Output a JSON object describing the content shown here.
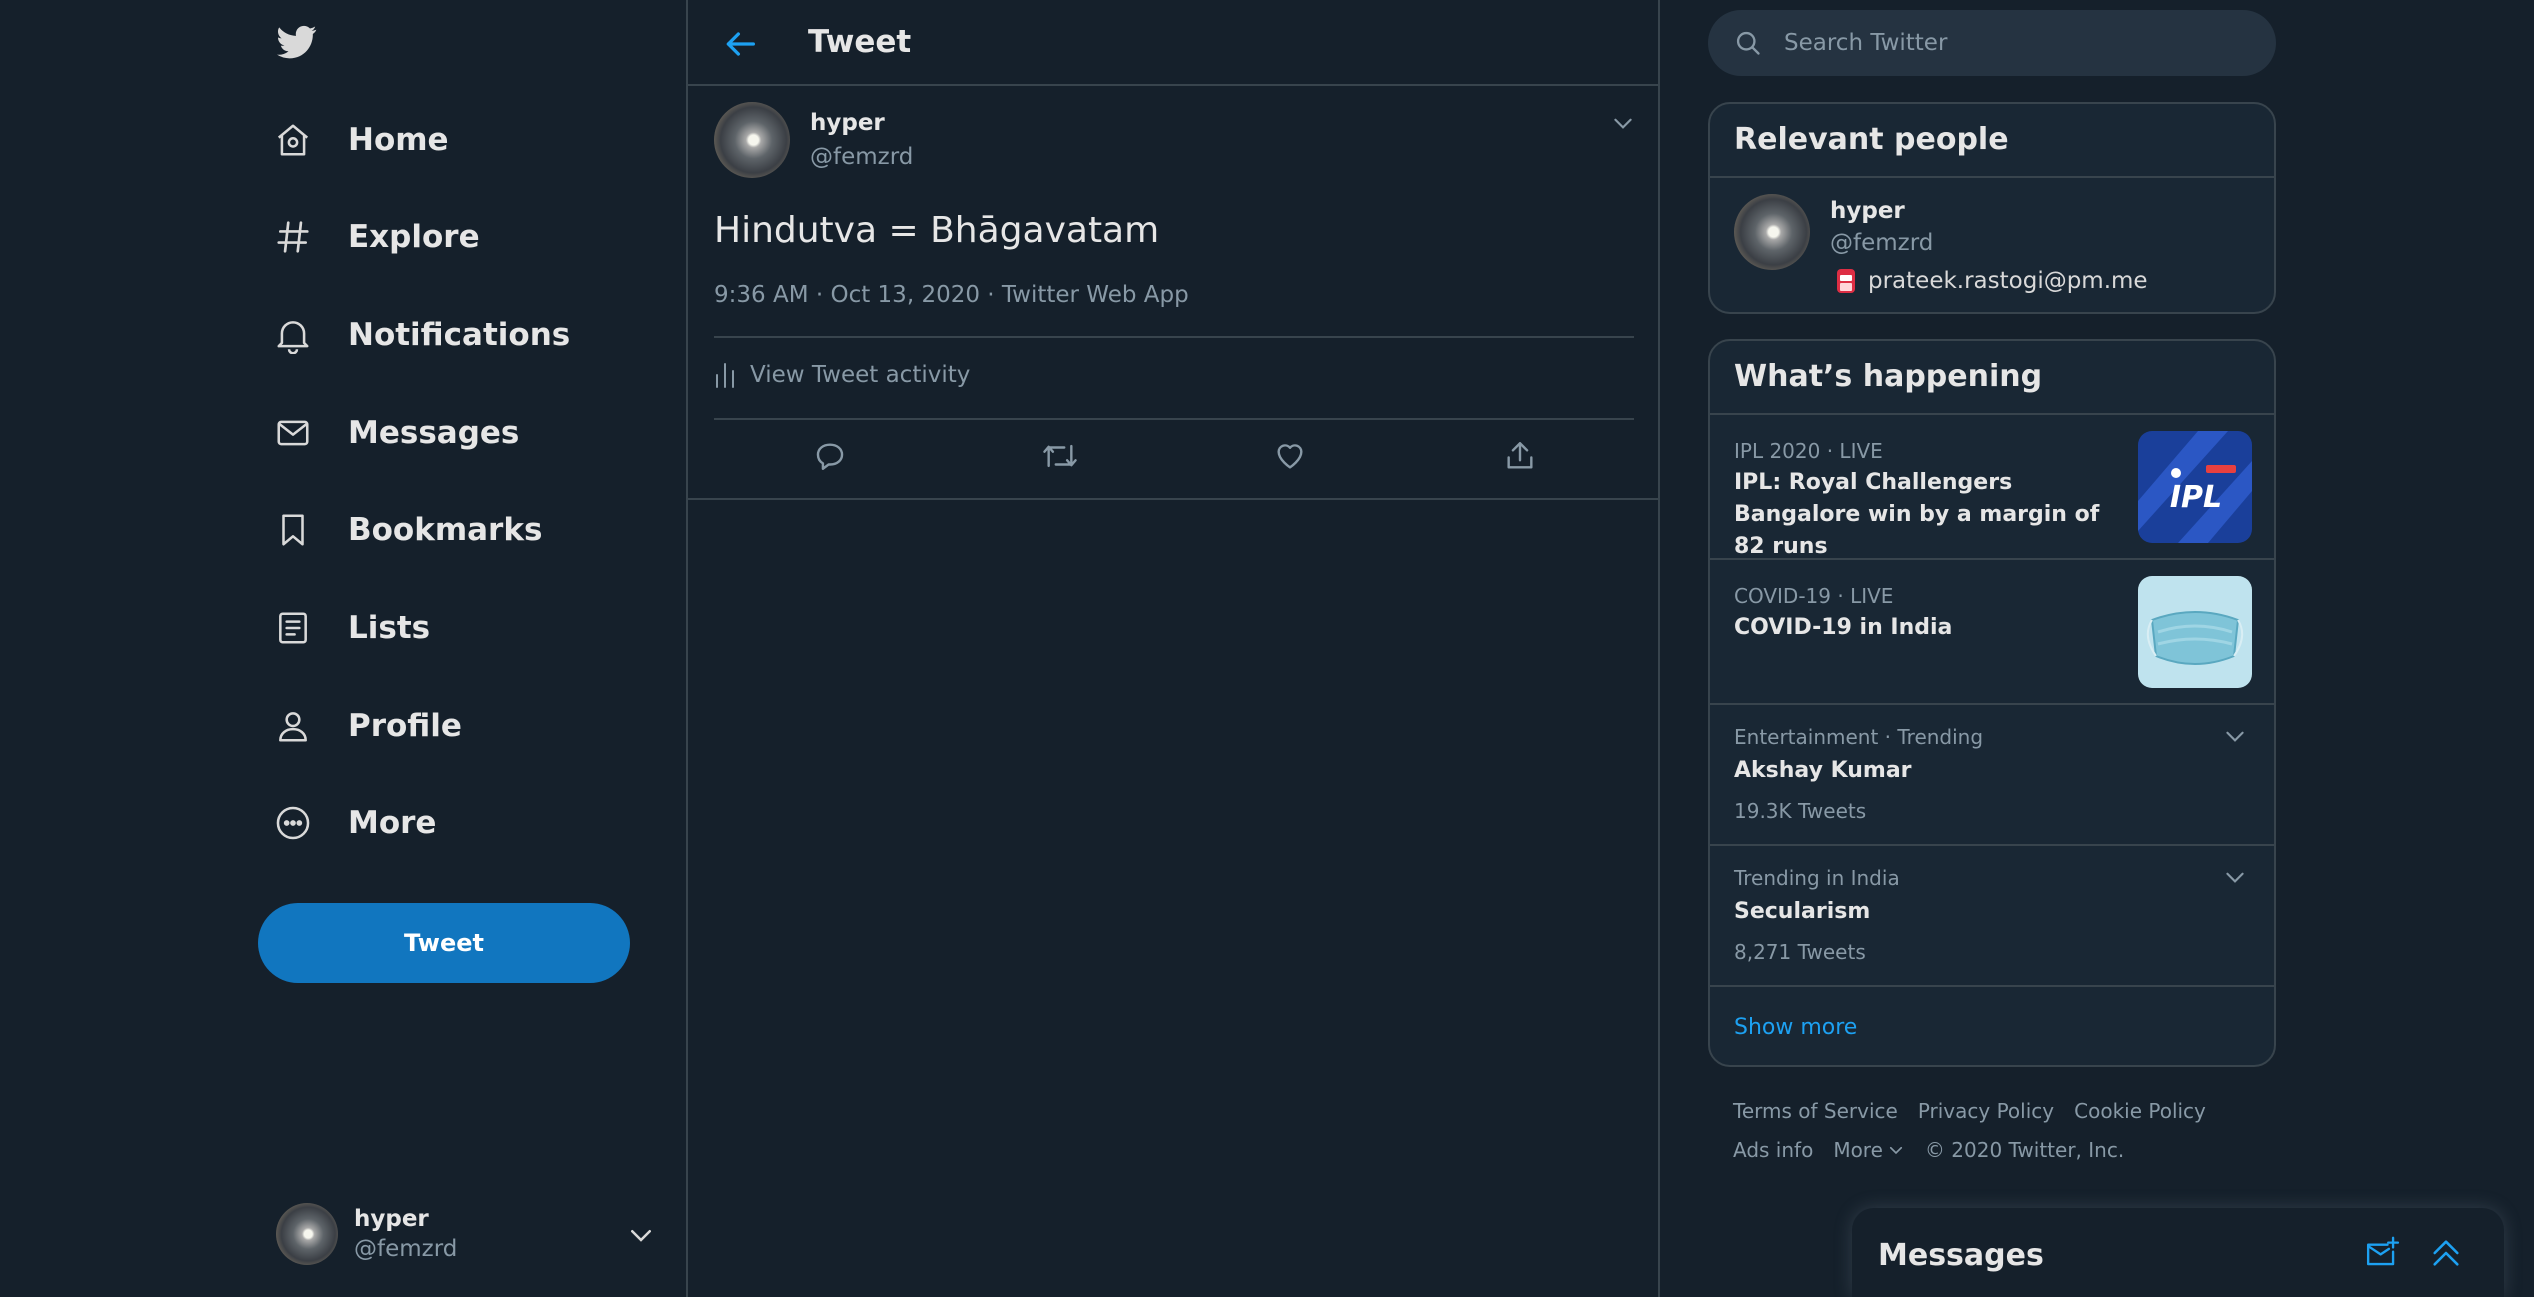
{
  "nav": {
    "items": [
      {
        "label": "Home",
        "icon": "home-icon"
      },
      {
        "label": "Explore",
        "icon": "hashtag-icon"
      },
      {
        "label": "Notifications",
        "icon": "bell-icon"
      },
      {
        "label": "Messages",
        "icon": "envelope-icon"
      },
      {
        "label": "Bookmarks",
        "icon": "bookmark-icon"
      },
      {
        "label": "Lists",
        "icon": "list-icon"
      },
      {
        "label": "Profile",
        "icon": "person-icon"
      },
      {
        "label": "More",
        "icon": "more-circle-icon"
      }
    ],
    "tweet_button": "Tweet",
    "account": {
      "name": "hyper",
      "handle": "@femzrd"
    }
  },
  "main": {
    "title": "Tweet",
    "tweet": {
      "name": "hyper",
      "handle": "@femzrd",
      "text": "Hindutva = Bhāgavatam",
      "meta": "9:36 AM · Oct 13, 2020 · Twitter Web App",
      "activity": "View Tweet activity"
    }
  },
  "search": {
    "placeholder": "Search Twitter"
  },
  "relevant": {
    "title": "Relevant people",
    "person": {
      "name": "hyper",
      "handle": "@femzrd",
      "bio": "prateek.rastogi@pm.me"
    }
  },
  "happening": {
    "title": "What’s happening",
    "trends": [
      {
        "context": "IPL 2020 · LIVE",
        "title": "IPL: Royal Challengers Bangalore win by a margin of 82 runs",
        "image": "ipl-logo"
      },
      {
        "context": "COVID-19 · LIVE",
        "title": "COVID-19 in India",
        "image": "face-mask"
      },
      {
        "context": "Entertainment · Trending",
        "title": "Akshay Kumar",
        "count": "19.3K Tweets"
      },
      {
        "context": "Trending in India",
        "title": "Secularism",
        "count": "8,271 Tweets"
      }
    ],
    "show_more": "Show more"
  },
  "footer": {
    "row1": [
      "Terms of Service",
      "Privacy Policy",
      "Cookie Policy"
    ],
    "row2": [
      "Ads info",
      "More",
      "© 2020 Twitter, Inc."
    ]
  },
  "messages_dock": {
    "title": "Messages"
  },
  "colors": {
    "background": "#15202b",
    "accent": "#1da1f2",
    "tweet_button": "#1176bf",
    "border": "#38444d",
    "muted": "#8899a6"
  }
}
